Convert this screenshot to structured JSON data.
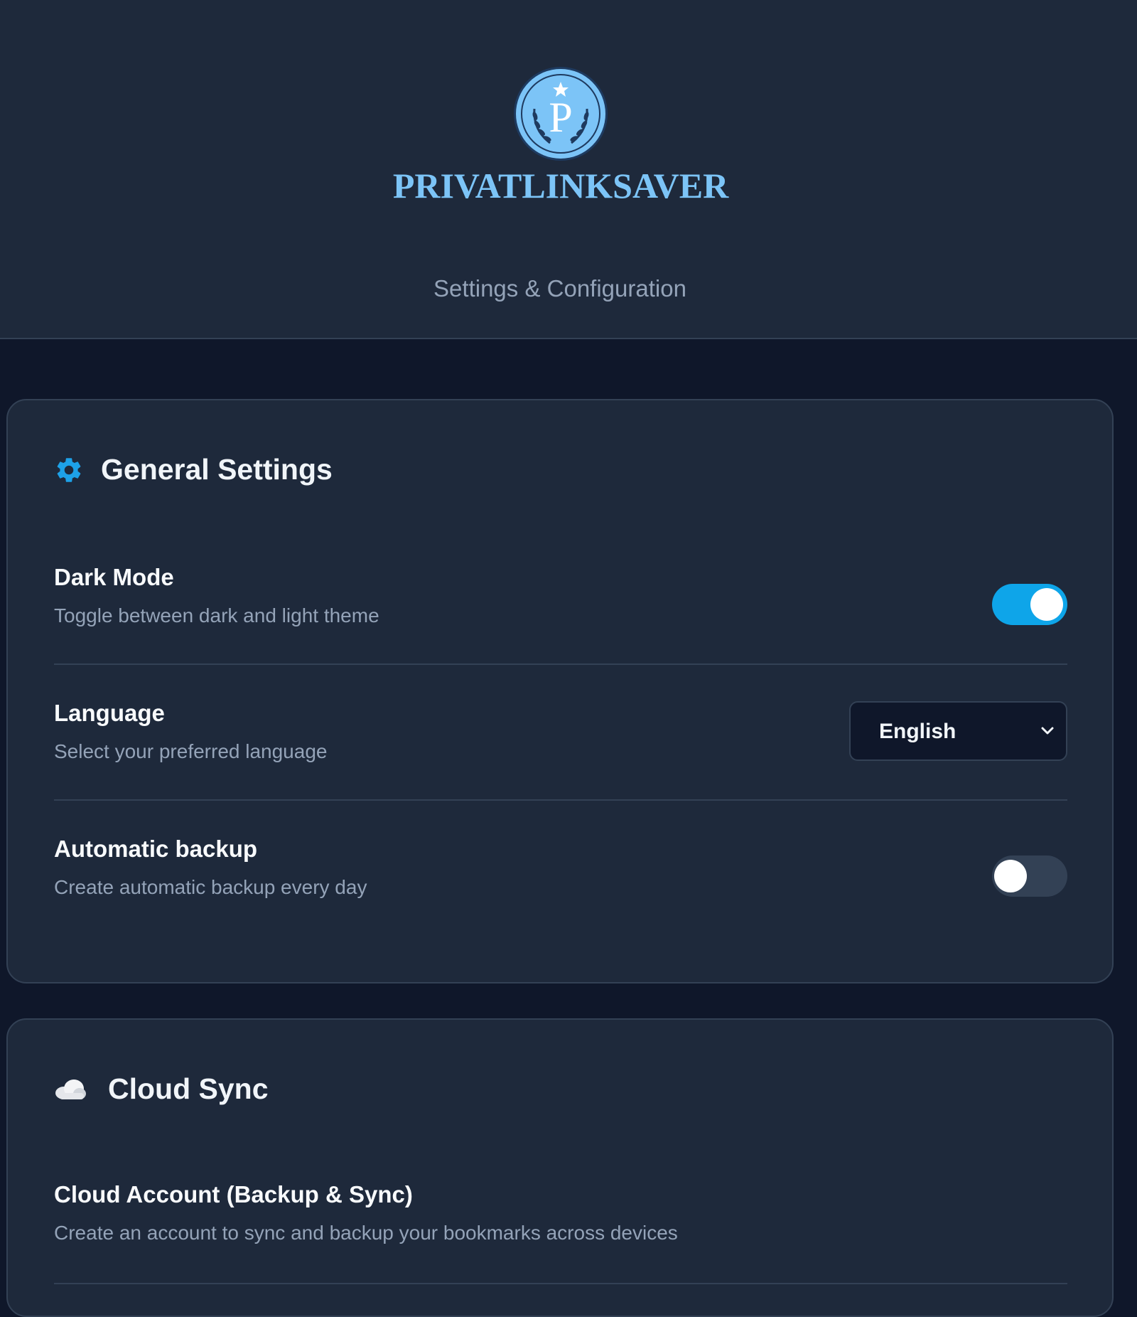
{
  "header": {
    "brand": "PRIVATLINKSAVER",
    "logo_letter": "P",
    "subtitle": "Settings & Configuration"
  },
  "general": {
    "title": "General Settings",
    "icon": "gear-icon",
    "settings": [
      {
        "label": "Dark Mode",
        "description": "Toggle between dark and light theme",
        "control": "toggle",
        "enabled": true
      },
      {
        "label": "Language",
        "description": "Select your preferred language",
        "control": "select",
        "value": "English"
      },
      {
        "label": "Automatic backup",
        "description": "Create automatic backup every day",
        "control": "toggle",
        "enabled": false
      }
    ]
  },
  "cloud": {
    "title": "Cloud Sync",
    "icon": "cloud-icon",
    "account": {
      "label": "Cloud Account (Backup & Sync)",
      "description": "Create an account to sync and backup your bookmarks across devices"
    }
  },
  "colors": {
    "accent": "#0ea5e9",
    "brand": "#7cc4f7",
    "background": "#0f172a",
    "card": "#1e293b"
  }
}
